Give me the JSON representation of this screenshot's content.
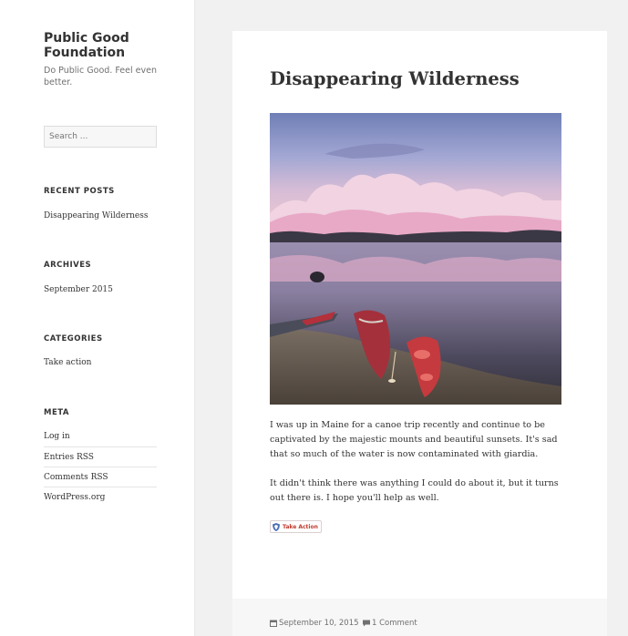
{
  "site": {
    "title": "Public Good Foundation",
    "description": "Do Public Good. Feel even better."
  },
  "sidebar": {
    "search_placeholder": "Search ...",
    "recent_posts": {
      "title": "RECENT POSTS",
      "items": [
        "Disappearing Wilderness"
      ]
    },
    "archives": {
      "title": "ARCHIVES",
      "items": [
        "September 2015"
      ]
    },
    "categories": {
      "title": "CATEGORIES",
      "items": [
        "Take action"
      ]
    },
    "meta": {
      "title": "META",
      "items": [
        "Log in",
        "Entries RSS",
        "Comments RSS",
        "WordPress.org"
      ]
    }
  },
  "post": {
    "title": "Disappearing Wilderness",
    "paragraphs": [
      "I was up in Maine for a canoe trip recently and continue to be captivated by the majestic mounts and beautiful sunsets. It's sad that so much of the water is now contaminated with giardia.",
      "It didn't think there was anything I could do about it, but it turns out there is. I hope you'll help as well."
    ],
    "button_label": "Take Action",
    "footer": {
      "date": "September 10, 2015",
      "comments": "1 Comment"
    }
  },
  "colors": {
    "page_bg": "#f1f1f1",
    "panel_bg": "#ffffff",
    "text": "#333333",
    "muted": "#707070",
    "button_accent": "#c0392b"
  },
  "icons": [
    "shield-icon",
    "calendar-icon",
    "comment-icon"
  ]
}
